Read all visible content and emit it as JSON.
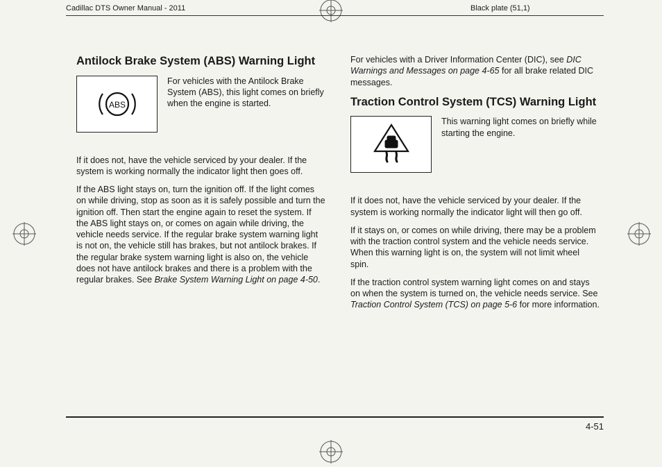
{
  "header": {
    "left": "Cadillac DTS Owner Manual - 2011",
    "right": "Black plate (51,1)"
  },
  "footer": {
    "page_number": "4-51"
  },
  "left_col": {
    "h_abs": "Antilock Brake System (ABS) Warning Light",
    "abs_icon_text": "For vehicles with the Antilock Brake System (ABS), this light comes on briefly when the engine is started.",
    "p1": "If it does not, have the vehicle serviced by your dealer. If the system is working normally the indicator light then goes off.",
    "p2_a": "If the ABS light stays on, turn the ignition off. If the light comes on while driving, stop as soon as it is safely possible and turn the ignition off. Then start the engine again to reset the system. If the ABS light stays on, or comes on again while driving, the vehicle needs service. If the regular brake system warning light is not on, the vehicle still has brakes, but not antilock brakes. If the regular brake system warning light is also on, the vehicle does not have antilock brakes and there is a problem with the regular brakes. See ",
    "p2_ref": "Brake System Warning Light on page 4-50",
    "p2_b": "."
  },
  "right_col": {
    "p0_a": "For vehicles with a Driver Information Center (DIC), see ",
    "p0_ref": "DIC Warnings and Messages on page 4-65",
    "p0_b": " for all brake related DIC messages.",
    "h_tcs": "Traction Control System (TCS) Warning Light",
    "tcs_icon_text": "This warning light comes on briefly while starting the engine.",
    "p1": "If it does not, have the vehicle serviced by your dealer. If the system is working normally the indicator light will then go off.",
    "p2": "If it stays on, or comes on while driving, there may be a problem with the traction control system and the vehicle needs service. When this warning light is on, the system will not limit wheel spin.",
    "p3_a": "If the traction control system warning light comes on and stays on when the system is turned on, the vehicle needs service. See ",
    "p3_ref": "Traction Control System (TCS) on page 5-6",
    "p3_b": " for more information."
  },
  "icons": {
    "abs_label": "ABS"
  }
}
